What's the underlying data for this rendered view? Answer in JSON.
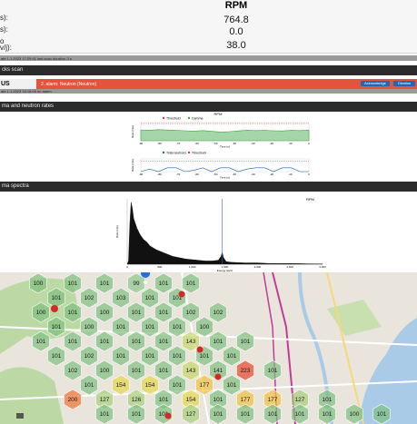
{
  "rpm_table": {
    "header": "RPM",
    "rows": [
      {
        "label": "s):",
        "value": "764.8"
      },
      {
        "label": "s):",
        "value": "0.0"
      },
      {
        "label": "o\nv/j):",
        "value": "38.0"
      }
    ],
    "footer_note": "ate 1.1.2023 17:29:41 last scan duration 3 s"
  },
  "alarm_section": {
    "title": "cks scan",
    "status_label": "US",
    "alarm_text": "2. alarm: Neutron (Neutron)",
    "acknowledge_label": "Acknowledge",
    "dismiss_label": "Dismiss",
    "footer_note": "ate 1.1.2023 16:18:00  on alarm"
  },
  "rates_section": {
    "title": "ma and neutron rates"
  },
  "spectra_section": {
    "title": "ma spectra"
  },
  "chart_data": [
    {
      "type": "line",
      "title": "RPM",
      "legend": [
        "Threshold",
        "Gamma"
      ],
      "colors": {
        "Threshold": "#e53935",
        "Gamma": "#43a047"
      },
      "ylabel": "Rate (cps)",
      "xlabel": "Time (s)",
      "x_ticks": [
        "-90",
        "-80",
        "-70",
        "-60",
        "-50",
        "-40",
        "-30",
        "-20",
        "-10",
        "0"
      ],
      "series": [
        {
          "name": "Gamma",
          "values": [
            60,
            58,
            61,
            59,
            57,
            55,
            53,
            56,
            52,
            48,
            50,
            54,
            58,
            56,
            57,
            55,
            54,
            57,
            56,
            59
          ]
        },
        {
          "name": "Threshold",
          "values": [
            95,
            95,
            95,
            95,
            95,
            95,
            95,
            95,
            95,
            95,
            95,
            95,
            95,
            95,
            95,
            95,
            95,
            95,
            95,
            95
          ]
        }
      ],
      "ylim": [
        0,
        100
      ]
    },
    {
      "type": "line",
      "legend": [
        "Total neutrons",
        "Threshold"
      ],
      "colors": {
        "Total neutrons": "#1e5bb5",
        "Threshold": "#e53935"
      },
      "ylabel": "Rate (cps)",
      "xlabel": "Time (s)",
      "x_ticks": [
        "-90",
        "-80",
        "-70",
        "-60",
        "-50",
        "-40",
        "-30",
        "-20",
        "-10",
        "0"
      ],
      "series": [
        {
          "name": "Total neutrons",
          "values": [
            0,
            2,
            0,
            3,
            3,
            0,
            1,
            3,
            0,
            3,
            3,
            0,
            2,
            3,
            3,
            0,
            3,
            3,
            0,
            0
          ]
        },
        {
          "name": "Threshold",
          "values": [
            8,
            8,
            8,
            8,
            8,
            8,
            8,
            8,
            8,
            8,
            8,
            8,
            8,
            8,
            8,
            8,
            8,
            8,
            8,
            8
          ]
        }
      ],
      "ylim": [
        0,
        10
      ]
    },
    {
      "type": "area",
      "title": "RPM",
      "xlabel": "Energy (keV)",
      "ylabel": "Rate (cps)",
      "x_ticks": [
        "0",
        "500",
        "1,000",
        "1,500",
        "2,000",
        "2,500",
        "3,000"
      ],
      "xlim": [
        0,
        3000
      ],
      "marker_line_x": 1460,
      "color": "#111111",
      "x": [
        20,
        40,
        60,
        80,
        100,
        150,
        200,
        250,
        300,
        350,
        400,
        450,
        500,
        600,
        700,
        800,
        900,
        1000,
        1100,
        1200,
        1300,
        1400,
        1440,
        1460,
        1480,
        1520,
        1600,
        1800,
        2000,
        2200,
        2400,
        2600,
        2800,
        3000
      ],
      "values": [
        5,
        60,
        95,
        85,
        70,
        55,
        45,
        38,
        34,
        28,
        25,
        22,
        20,
        16,
        12,
        10,
        8,
        7,
        6,
        5,
        5,
        6,
        12,
        18,
        10,
        4,
        3,
        2,
        2,
        1,
        1,
        1,
        0.5,
        0.3
      ]
    }
  ],
  "map": {
    "hex_colors": {
      "100": "#7fbf7f",
      "101": "#7fbf7f",
      "102": "#7fbf7f",
      "103": "#7fbf7f",
      "99": "#8fc78f",
      "143": "#c4d86a",
      "154": "#e3d94e",
      "177": "#f0c040",
      "200": "#f07030",
      "223": "#e8442a",
      "127": "#a6cf7a",
      "126": "#a6cf7a"
    },
    "labels": [
      "100",
      "101",
      "101",
      "99",
      "101",
      "101",
      "101",
      "102",
      "103",
      "101",
      "101",
      "100",
      "101",
      "100",
      "101",
      "101",
      "102",
      "102",
      "101",
      "100",
      "101",
      "101",
      "101",
      "100",
      "101",
      "101",
      "101",
      "101",
      "101",
      "143",
      "101",
      "101",
      "101",
      "102",
      "101",
      "101",
      "101",
      "101",
      "101",
      "102",
      "100",
      "101",
      "101",
      "143",
      "141",
      "223",
      "101",
      "101",
      "154",
      "154",
      "101",
      "177",
      "101",
      "200",
      "127",
      "126",
      "101",
      "154",
      "101",
      "177",
      "177",
      "127",
      "101",
      "101",
      "101",
      "101",
      "127",
      "101",
      "101",
      "101",
      "101",
      "101",
      "100",
      "101",
      "101",
      "127",
      "101",
      "101",
      "100",
      "101",
      "101"
    ]
  }
}
